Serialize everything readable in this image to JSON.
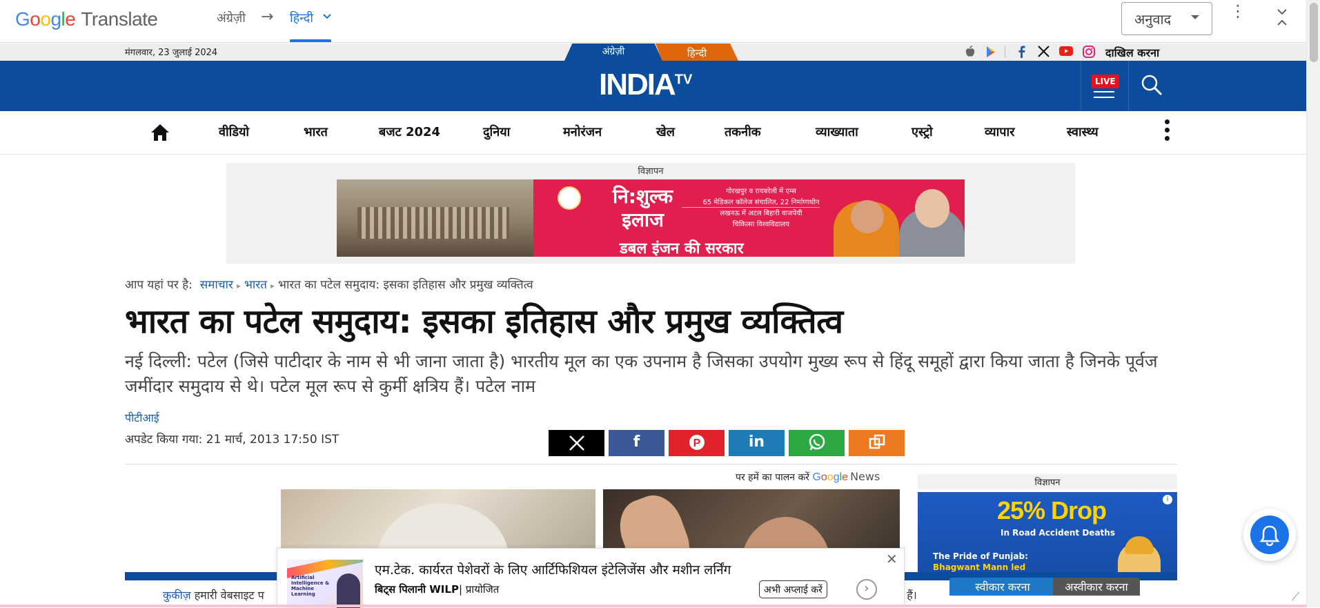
{
  "translate_bar": {
    "logo_google": [
      "G",
      "o",
      "o",
      "g",
      "l",
      "e"
    ],
    "logo_product": "Translate",
    "source_lang": "अंग्रेज़ी",
    "arrow": "→",
    "target_lang": "हिन्दी",
    "select_value": "अनुवाद"
  },
  "top_strip": {
    "date": "मंगलवार, 23 जुलाई 2024",
    "lang_english": "अंग्रेज़ी",
    "lang_hindi": "हिन्दी",
    "login": "दाखिल करना"
  },
  "header": {
    "logo_main": "INDIA",
    "logo_sup": "TV",
    "live_label": "LIVE"
  },
  "nav": {
    "items": [
      "वीडियो",
      "भारत",
      "बजट 2024",
      "दुनिया",
      "मनोरंजन",
      "खेल",
      "तकनीक",
      "व्याख्याता",
      "एस्ट्रो",
      "व्यापार",
      "स्वास्थ्य"
    ]
  },
  "ad": {
    "label": "विज्ञापन",
    "main_line1": "नि:शुल्क",
    "main_line2": "इलाज",
    "sub_line1": "गोरखपुर व रायबरेली में एम्स",
    "sub_line2": "65 मेडिकल कॉलेज संचालित, 22 निर्माणाधीन",
    "sub_line3": "लखनऊ में अटल बिहारी वाजपेयी",
    "sub_line4": "चिकित्सा विश्वविद्यालय",
    "bottom": "डबल इंजन की सरकार"
  },
  "breadcrumb": {
    "prefix": "आप यहां पर है:",
    "items": [
      "समाचार",
      "भारत"
    ],
    "current": "भारत का पटेल समुदाय: इसका इतिहास और प्रमुख व्यक्तित्व"
  },
  "article": {
    "headline": "भारत का पटेल समुदाय: इसका इतिहास और प्रमुख व्यक्तित्व",
    "summary": "नई दिल्ली: पटेल (जिसे पाटीदार के नाम से भी जाना जाता है) भारतीय मूल का एक उपनाम है जिसका उपयोग मुख्य रूप से हिंदू समूहों द्वारा किया जाता है जिनके पूर्वज जमींदार समुदाय से थे। पटेल मूल रूप से कुर्मी क्षत्रिय हैं। पटेल नाम",
    "author": "पीटीआई",
    "updated": "अपडेट किया गया: 21 मार्च, 2013 17:50 IST"
  },
  "share": {
    "buttons": [
      {
        "name": "x",
        "glyph": "𝕏",
        "color": "#000000"
      },
      {
        "name": "facebook",
        "glyph": "f",
        "color": "#3b5998"
      },
      {
        "name": "pinterest",
        "glyph": "℗",
        "color": "#e0232a"
      },
      {
        "name": "linkedin",
        "glyph": "in",
        "color": "#1f7bb5"
      },
      {
        "name": "whatsapp",
        "glyph": "✆",
        "color": "#2ca943"
      },
      {
        "name": "copy",
        "glyph": "⧉",
        "color": "#ec7a22"
      }
    ]
  },
  "follow": {
    "text": "पर हमें का पालन करें",
    "google": [
      "G",
      "o",
      "o",
      "g",
      "l",
      "e"
    ],
    "news": "News"
  },
  "side_ad": {
    "label": "विज्ञापन",
    "big": "25% Drop",
    "small": "In Road Accident Deaths",
    "line1": "The Pride of Punjab:",
    "line2": "Bhagwant Mann led"
  },
  "cookie": {
    "link": "कुकीज़",
    "text": "हमारी वेबसाइट प",
    "tail": "ते हैं।",
    "accept": "स्वीकार करना",
    "reject": "अस्वीकार करना"
  },
  "popup": {
    "thumb_text": "Artificial Intelligence & Machine Learning",
    "title": "एम.टेक. कार्यरत पेशेवरों के लिए आर्टिफिशियल इंटेलिजेंस और मशीन लर्निंग",
    "brand_bold": "बिट्स पिलानी WILP",
    "brand_rest": "| प्रायोजित",
    "cta": "अभी अप्लाई करें",
    "next": "›",
    "close": "✕"
  },
  "colors": {
    "brand_blue": "#0b4d9c",
    "hindi_orange": "#e0660d",
    "link_blue": "#1d5ea8",
    "ad_red": "#e11f4f"
  }
}
